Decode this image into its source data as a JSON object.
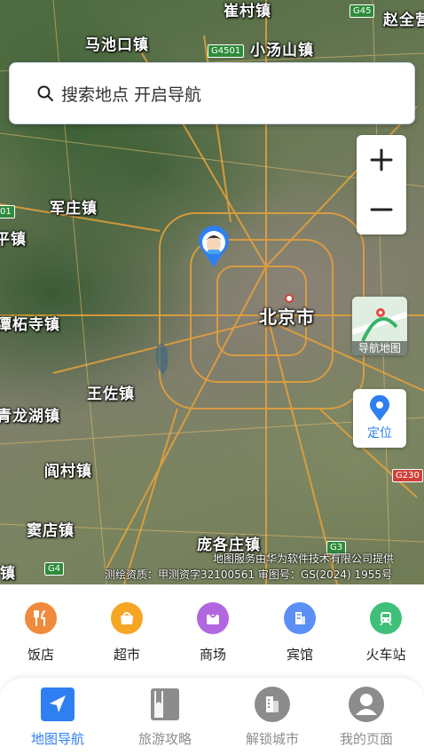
{
  "search": {
    "placeholder_text": "搜索地点 开启导航",
    "icon": "search-icon"
  },
  "map": {
    "places": [
      {
        "key": "cuncun",
        "label": "崔村镇"
      },
      {
        "key": "zhaoquan",
        "label": "赵全营"
      },
      {
        "key": "machikou",
        "label": "马池口镇"
      },
      {
        "key": "xiaotangshan",
        "label": "小汤山镇"
      },
      {
        "key": "junzhuang",
        "label": "军庄镇"
      },
      {
        "key": "pingzhen",
        "label": "平镇"
      },
      {
        "key": "tanzhesi",
        "label": "潭柘寺镇"
      },
      {
        "key": "beijing",
        "label": "北京市"
      },
      {
        "key": "wangzuo",
        "label": "王佐镇"
      },
      {
        "key": "qinglonghu",
        "label": "青龙湖镇"
      },
      {
        "key": "yancun",
        "label": "阎村镇"
      },
      {
        "key": "doudian",
        "label": "窦店镇"
      },
      {
        "key": "pangezhuang",
        "label": "庞各庄镇"
      },
      {
        "key": "zhen",
        "label": "镇"
      }
    ],
    "shields": [
      {
        "key": "g45",
        "label": "G45",
        "color": "green"
      },
      {
        "key": "g4501",
        "label": "G4501",
        "color": "green"
      },
      {
        "key": "left01",
        "label": "01",
        "color": "green"
      },
      {
        "key": "g230",
        "label": "G230",
        "color": "red"
      },
      {
        "key": "g3",
        "label": "G3",
        "color": "green"
      },
      {
        "key": "g4",
        "label": "G4",
        "color": "green"
      }
    ],
    "credit_line1": "地图服务由华为软件技术有限公司提供",
    "credit_line2": "测绘资质：甲测资字32100561   审图号：GS(2024) 1955号",
    "zoom_in": "+",
    "zoom_out": "−",
    "navmap_label": "导航地图",
    "locate_label": "定位",
    "colors": {
      "accent": "#2f7ff2",
      "road": "#e8a23a"
    }
  },
  "categories": [
    {
      "label": "饭店",
      "icon": "restaurant-icon",
      "color": "#f08a3c"
    },
    {
      "label": "超市",
      "icon": "supermarket-icon",
      "color": "#f6a623"
    },
    {
      "label": "商场",
      "icon": "mall-icon",
      "color": "#b266e0"
    },
    {
      "label": "宾馆",
      "icon": "hotel-icon",
      "color": "#5b8ff5"
    },
    {
      "label": "火车站",
      "icon": "train-icon",
      "color": "#3fc07a"
    }
  ],
  "tabs": [
    {
      "label": "地图导航",
      "icon": "navigation-icon",
      "active": true
    },
    {
      "label": "旅游攻略",
      "icon": "book-icon",
      "active": false
    },
    {
      "label": "解锁城市",
      "icon": "city-icon",
      "active": false
    },
    {
      "label": "我的页面",
      "icon": "user-icon",
      "active": false
    }
  ]
}
